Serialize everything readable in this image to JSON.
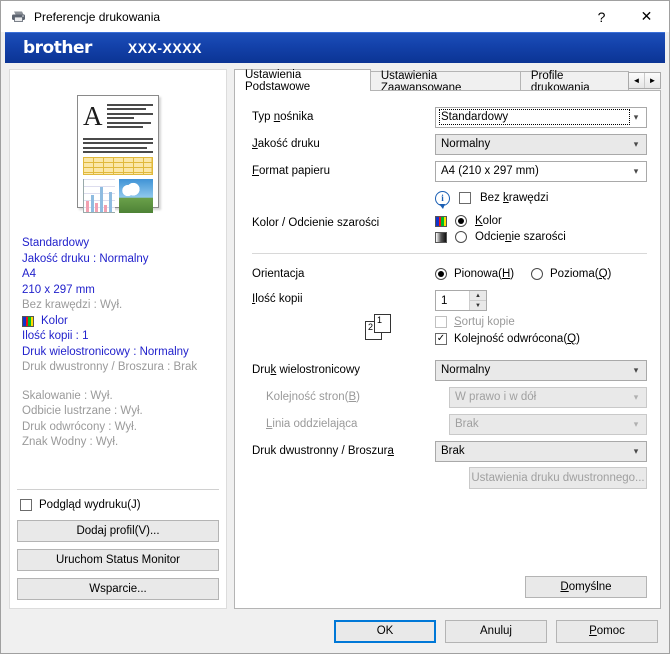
{
  "window": {
    "title": "Preferencje drukowania",
    "icon": "printer-icon",
    "help_glyph": "?",
    "close_glyph": "✕"
  },
  "banner": {
    "brand": "brother",
    "model": "XXX-XXXX",
    "color": "#1442ab"
  },
  "preview": {
    "letter": "A",
    "alt": "document-preview-thumbnail"
  },
  "summary": {
    "lines": [
      {
        "text": "Standardowy",
        "style": "blue"
      },
      {
        "text": "Jakość druku : Normalny",
        "style": "blue"
      },
      {
        "text": "A4",
        "style": "blue"
      },
      {
        "text": "210 x 297 mm",
        "style": "blue"
      },
      {
        "text": "Bez krawędzi : Wył.",
        "style": "gray"
      }
    ],
    "color_label": "Kolor",
    "lines2": [
      {
        "text": "Ilość kopii  : 1",
        "style": "blue"
      },
      {
        "text": "Druk wielostronicowy  : Normalny",
        "style": "blue"
      },
      {
        "text": "Druk dwustronny / Broszura : Brak",
        "style": "gray"
      }
    ],
    "lines3": [
      {
        "text": "Skalowanie : Wył.",
        "style": "gray"
      },
      {
        "text": "Odbicie lustrzane  : Wył.",
        "style": "gray"
      },
      {
        "text": "Druk odwrócony  : Wył.",
        "style": "gray"
      },
      {
        "text": "Znak Wodny : Wył.",
        "style": "gray"
      }
    ]
  },
  "left_bottom": {
    "preview_checkbox": {
      "label": "Podgląd wydruku(J)",
      "checked": false
    },
    "add_profile": "Dodaj profil(V)...",
    "status_monitor": "Uruchom Status Monitor",
    "support": "Wsparcie..."
  },
  "tabs": [
    {
      "label": "Ustawienia Podstawowe",
      "active": true
    },
    {
      "label": "Ustawienia Zaawansowane",
      "active": false
    },
    {
      "label": "Profile drukowania",
      "active": false
    }
  ],
  "tab_nav": {
    "prev": "◄",
    "next": "►"
  },
  "settings": {
    "media_type": {
      "label": "Typ nośnika",
      "value": "Standardowy",
      "focused": true
    },
    "print_quality": {
      "label": "Jakość druku",
      "value": "Normalny"
    },
    "paper_size": {
      "label": "Format papieru",
      "value": "A4 (210 x 297 mm)"
    },
    "borderless": {
      "label": "Bez krawędzi",
      "checked": false,
      "info_icon": "info-icon"
    },
    "color_mode": {
      "label": "Kolor / Odcienie szarości",
      "options": [
        {
          "label": "Kolor",
          "selected": true,
          "icon": "color-swatch-icon"
        },
        {
          "label": "Odcienie szarości",
          "selected": false,
          "icon": "grayscale-swatch-icon"
        }
      ]
    },
    "orientation": {
      "label": "Orientacja",
      "options": [
        {
          "label": "Pionowa(H)",
          "selected": true
        },
        {
          "label": "Pozioma(Q)",
          "selected": false
        }
      ]
    },
    "copies": {
      "label": "Ilość kopii",
      "value": "1"
    },
    "collate": {
      "label": "Sortuj kopie",
      "checked": false,
      "disabled": true
    },
    "reverse_order": {
      "label": "Kolejność odwrócona(Q)",
      "checked": true
    },
    "page_order_icon": {
      "page1": "1",
      "page2": "2"
    },
    "multipage": {
      "label": "Druk wielostronicowy",
      "value": "Normalny"
    },
    "page_order": {
      "label": "Kolejność stron(B)",
      "value": "W prawo i w dół",
      "disabled": true
    },
    "border_line": {
      "label": "Linia oddzielająca",
      "value": "Brak",
      "disabled": true
    },
    "duplex": {
      "label": "Druk dwustronny / Broszura",
      "value": "Brak"
    },
    "duplex_settings_button": {
      "label": "Ustawienia druku dwustronnego...",
      "disabled": true
    },
    "defaults_button": "Domyślne"
  },
  "footer": {
    "ok": "OK",
    "cancel": "Anuluj",
    "help": "Pomoc"
  }
}
